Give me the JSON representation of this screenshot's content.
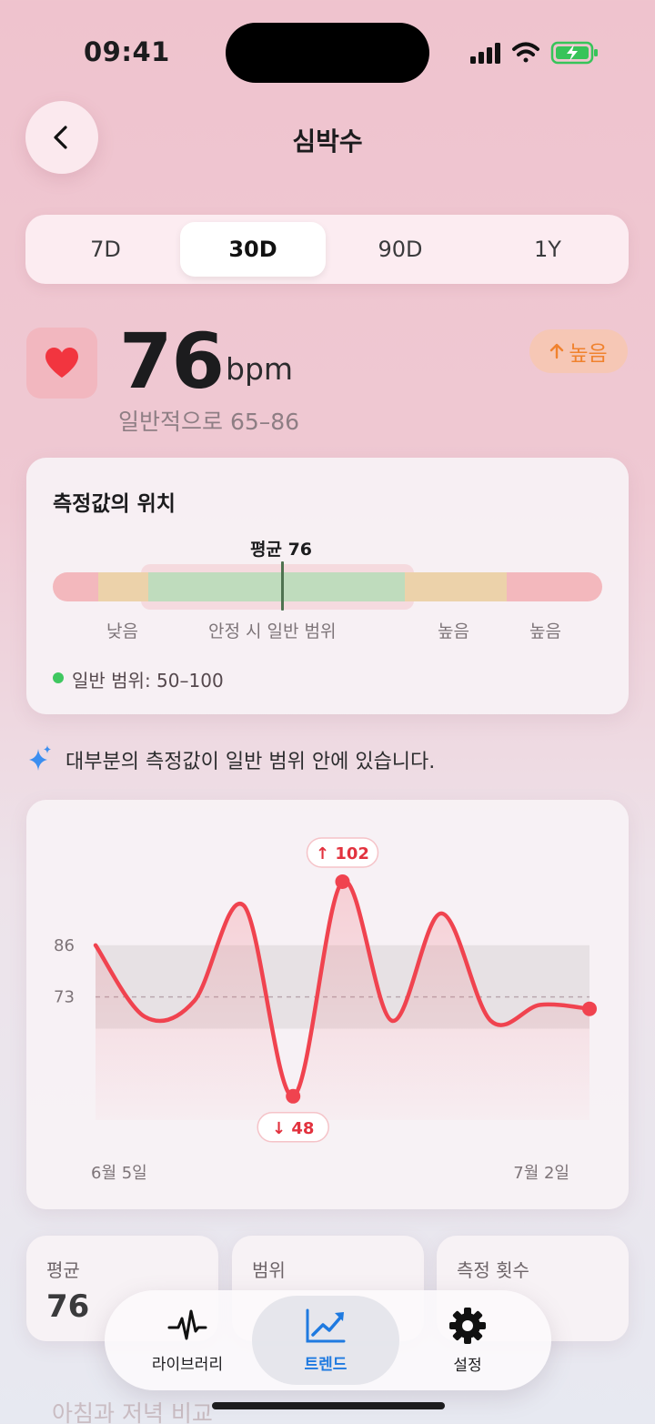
{
  "status_bar": {
    "time": "09:41"
  },
  "header": {
    "title": "심박수",
    "back_icon": "chevron-left-icon"
  },
  "segments": [
    {
      "label": "7D",
      "active": false
    },
    {
      "label": "30D",
      "active": true
    },
    {
      "label": "90D",
      "active": false
    },
    {
      "label": "1Y",
      "active": false
    }
  ],
  "metric": {
    "value": "76",
    "unit": "bpm",
    "typical_range": "일반적으로 65–86",
    "badge": "높음",
    "badge_icon": "arrow-up-icon",
    "badge_color": "#f0822e"
  },
  "position_card": {
    "title": "측정값의 위치",
    "average_label": "평균 76",
    "labels": [
      "낮음",
      "안정 시 일반 범위",
      "높음",
      "높음"
    ],
    "legend": "일반 범위: 50–100"
  },
  "insight": "대부분의 측정값이 일반 범위 안에 있습니다.",
  "chart_data": {
    "type": "line",
    "x_start_label": "6월 5일",
    "x_end_label": "7월 2일",
    "y_ticks": [
      "86",
      "73"
    ],
    "band": [
      65,
      86
    ],
    "reference": 73,
    "ylim": [
      42,
      110
    ],
    "series": [
      {
        "values": [
          86,
          68,
          72,
          96,
          48,
          102,
          67,
          94,
          67,
          71,
          70
        ]
      }
    ],
    "max_label": "102",
    "min_label": "48",
    "line_color": "#f0434f"
  },
  "stats": [
    {
      "label": "평균",
      "value": "76"
    },
    {
      "label": "범위",
      "value": ""
    },
    {
      "label": "측정 횟수",
      "value": ""
    }
  ],
  "faded_section_title": "아침과 저녁 비교",
  "tabbar": [
    {
      "label": "라이브러리",
      "icon": "heartbeat-icon",
      "active": false
    },
    {
      "label": "트렌드",
      "icon": "chart-trend-icon",
      "active": true
    },
    {
      "label": "설정",
      "icon": "gear-icon",
      "active": false
    }
  ]
}
